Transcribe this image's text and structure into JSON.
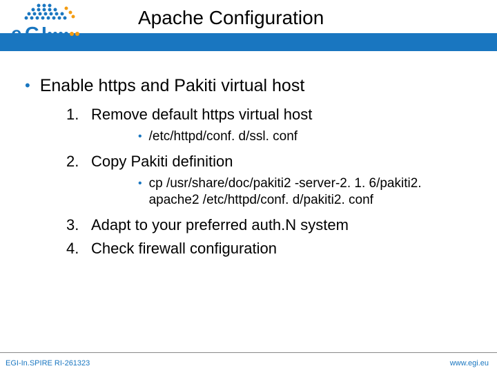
{
  "header": {
    "title": "Apache Configuration"
  },
  "main": {
    "bullet": "Enable https and Pakiti virtual host",
    "items": [
      {
        "num": "1.",
        "text": "Remove default https virtual host",
        "sub": "/etc/httpd/conf. d/ssl. conf"
      },
      {
        "num": "2.",
        "text": "Copy Pakiti definition",
        "sub": "cp /usr/share/doc/pakiti2 -server-2. 1. 6/pakiti2. apache2 /etc/httpd/conf. d/pakiti2. conf"
      },
      {
        "num": "3.",
        "text": "Adapt to your preferred auth.N system"
      },
      {
        "num": "4.",
        "text": "Check firewall configuration"
      }
    ]
  },
  "footer": {
    "left": "EGI-In.SPIRE RI-261323",
    "right": "www.egi.eu"
  }
}
